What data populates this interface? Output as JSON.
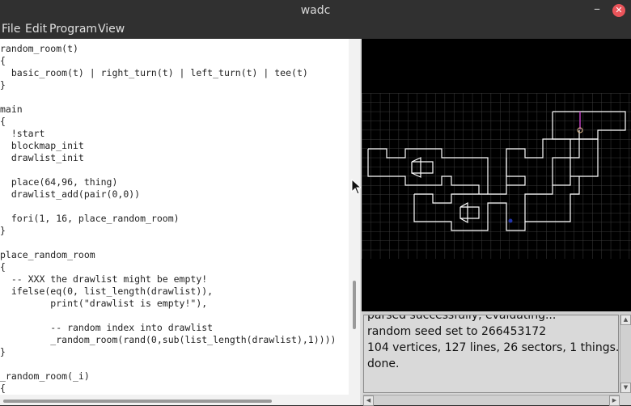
{
  "window": {
    "title": "wadc",
    "minimize_glyph": "–",
    "close_glyph": "✕"
  },
  "menu": {
    "items": [
      "File",
      "Edit",
      "Program",
      "View"
    ]
  },
  "editor": {
    "lines": [
      "random_room(t)",
      "{",
      "  basic_room(t) | right_turn(t) | left_turn(t) | tee(t)",
      "}",
      "",
      "main",
      "{",
      "  !start",
      "  blockmap_init",
      "  drawlist_init",
      "",
      "  place(64,96, thing)",
      "  drawlist_add(pair(0,0))",
      "",
      "  fori(1, 16, place_random_room)",
      "}",
      "",
      "place_random_room",
      "{",
      "  -- XXX the drawlist might be empty!",
      "  ifelse(eq(0, list_length(drawlist)),",
      "         print(\"drawlist is empty!\"),",
      "",
      "         -- random index into drawlist",
      "         _random_room(rand(0,sub(list_length(drawlist),1))))",
      "}",
      "",
      "_random_room(_i)",
      "{"
    ]
  },
  "console": {
    "lines": [
      "parsed successfully, evaluating...",
      "random seed set to 266453172",
      "104 vertices, 127 lines, 26 sectors, 1 things.",
      "done."
    ]
  },
  "colors": {
    "map_background": "#000000",
    "map_grid": "#3a3a3a",
    "map_lines": "#ffffff",
    "start_marker": "#c040c0",
    "thing_marker": "#2233aa"
  }
}
